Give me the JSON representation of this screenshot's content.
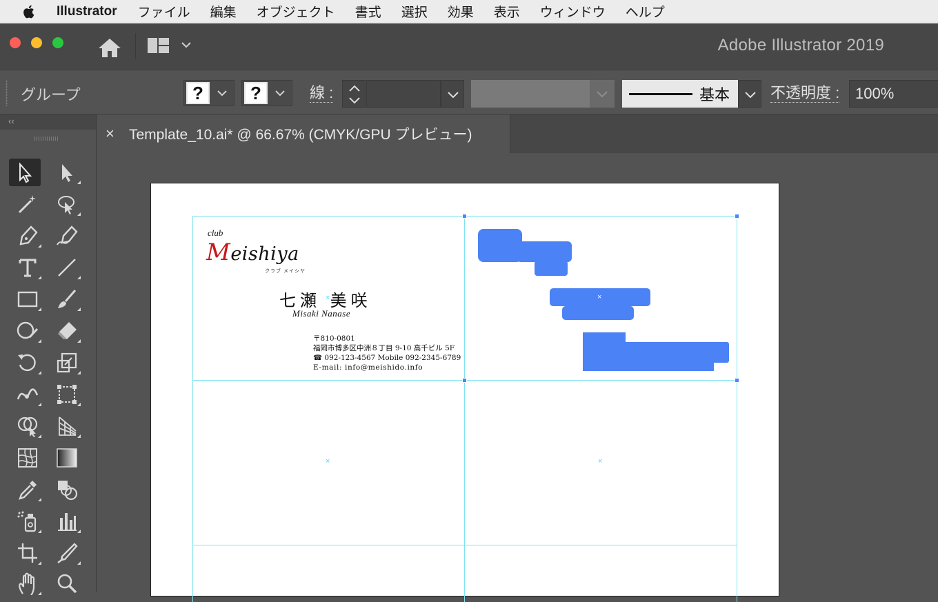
{
  "menubar": {
    "app": "Illustrator",
    "items": [
      "ファイル",
      "編集",
      "オブジェクト",
      "書式",
      "選択",
      "効果",
      "表示",
      "ウィンドウ",
      "ヘルプ"
    ]
  },
  "window": {
    "title": "Adobe Illustrator 2019"
  },
  "control": {
    "selection_label": "グループ",
    "fill": "?",
    "stroke": "?",
    "stroke_label": "線 :",
    "brush_label": "基本",
    "opacity_label": "不透明度 :",
    "opacity_value": "100%"
  },
  "toolbar": {
    "collapse": "‹‹"
  },
  "tab": {
    "close": "×",
    "title": "Template_10.ai* @ 66.67% (CMYK/GPU プレビュー)"
  },
  "card": {
    "club": "club",
    "logo_initial": "M",
    "logo_rest": "eishiya",
    "logo_kana": "クラブ メイシヤ",
    "name": "七瀬 美咲",
    "roman": "Misaki Nanase",
    "postal": "〒810-0801",
    "address": "福岡市博多区中洲８丁目 9-10 高千ビル 5F",
    "phone": "☎ 092-123-4567  Mobile 092-2345-6789",
    "email": "E-mail: info@meishido.info"
  },
  "colors": {
    "guide": "#7fe4f0",
    "selection": "#4b82f5",
    "logo_red": "#c41a1a"
  }
}
